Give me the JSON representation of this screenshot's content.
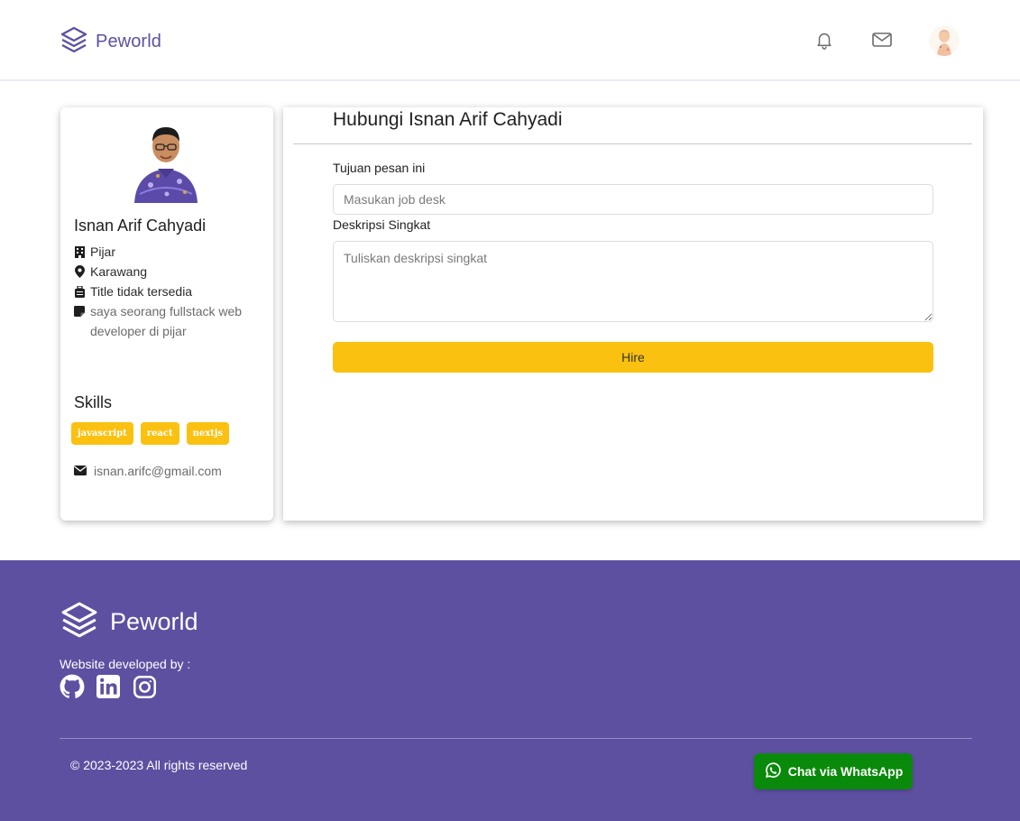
{
  "header": {
    "brand": "Peworld",
    "icons": [
      "layers-logo-icon",
      "bell-icon",
      "envelope-icon",
      "avatar"
    ]
  },
  "profile": {
    "name": "Isnan Arif Cahyadi",
    "company": "Pijar",
    "location": "Karawang",
    "job_title": "Title tidak tersedia",
    "description": "saya seorang fullstack web developer di pijar",
    "skills_heading": "Skills",
    "skills": [
      "javascript",
      "react",
      "nextjs"
    ],
    "email": "isnan.arifc@gmail.com"
  },
  "contact_form": {
    "title": "Hubungi Isnan Arif Cahyadi",
    "purpose_label": "Tujuan pesan ini",
    "purpose_placeholder": "Masukan job desk",
    "description_label": "Deskripsi Singkat",
    "description_placeholder": "Tuliskan deskripsi singkat",
    "submit_label": "Hire"
  },
  "footer": {
    "brand": "Peworld",
    "developed_by": "Website developed by :",
    "social_icons": [
      "github-icon",
      "linkedin-icon",
      "instagram-icon"
    ],
    "copyright": "© 2023-2023 All rights reserved",
    "whatsapp_label": "Chat via WhatsApp"
  },
  "colors": {
    "brand_purple": "#5e50a1",
    "accent_yellow": "#fbc110",
    "whatsapp_green": "#0a8a0a"
  }
}
